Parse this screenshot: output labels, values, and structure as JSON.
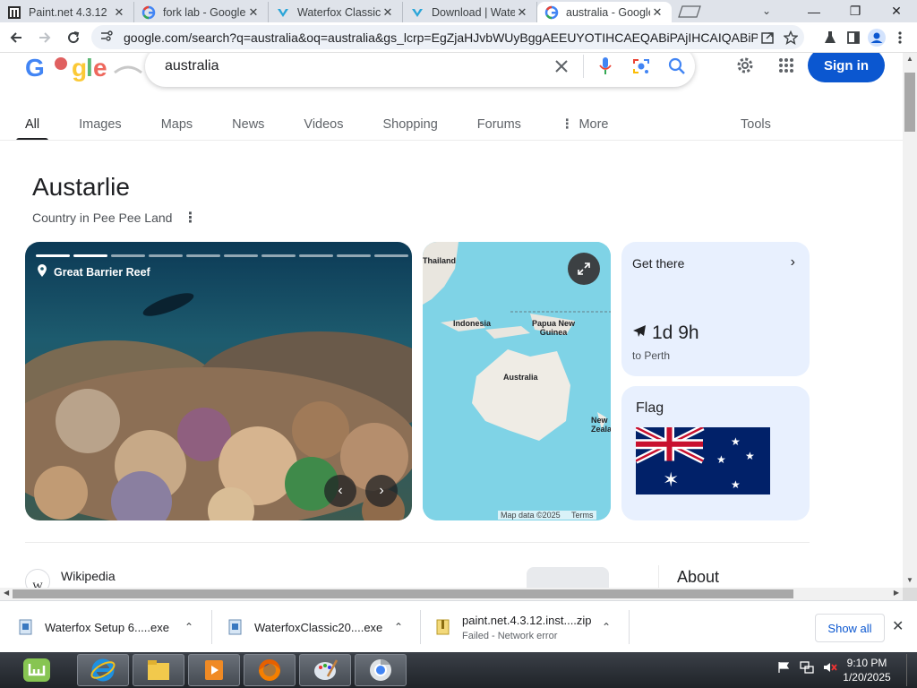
{
  "browser": {
    "tabs": [
      {
        "title": "Paint.net 4.3.12",
        "icon": "paintnet-icon",
        "active": false
      },
      {
        "title": "fork lab - Google",
        "icon": "google-icon",
        "active": false
      },
      {
        "title": "Waterfox Classic",
        "icon": "waterfox-icon",
        "active": false
      },
      {
        "title": "Download | Waterfox",
        "icon": "waterfox-icon",
        "active": false
      },
      {
        "title": "australia - Google",
        "icon": "google-icon",
        "active": true
      }
    ],
    "url": "google.com/search?q=australia&oq=australia&gs_lcrp=EgZjaHJvbWUyBggAEEUYOTIHCAEQABiPAjIHCAIQABiPAjIHCAM"
  },
  "google": {
    "logo_text": "Google",
    "query": "australia",
    "sign_in": "Sign in",
    "tabs": [
      "All",
      "Images",
      "Maps",
      "News",
      "Videos",
      "Shopping",
      "Forums",
      "More"
    ],
    "tools": "Tools"
  },
  "knowledge_panel": {
    "title": "Austarlie",
    "subtitle": "Country in Pee Pee Land",
    "photo_caption": "Great Barrier Reef",
    "map": {
      "labels": [
        "Thailand",
        "Indonesia",
        "Papua New Guinea",
        "Australia",
        "New Zealand"
      ],
      "footer": "Map data ©2025",
      "terms": "Terms"
    },
    "get_there": {
      "title": "Get there",
      "duration": "1d 9h",
      "destination": "to Perth"
    },
    "flag_title": "Flag",
    "source": "Wikipedia",
    "about": "About"
  },
  "downloads": [
    {
      "name": "Waterfox Setup 6.....exe",
      "status": ""
    },
    {
      "name": "WaterfoxClassic20....exe",
      "status": ""
    },
    {
      "name": "paint.net.4.3.12.inst....zip",
      "status": "Failed - Network error"
    }
  ],
  "downloads_show_all": "Show all",
  "taskbar": {
    "time": "9:10 PM",
    "date": "1/20/2025"
  },
  "colors": {
    "accent": "#0b57d0",
    "card_bg": "#e8f0fe"
  }
}
